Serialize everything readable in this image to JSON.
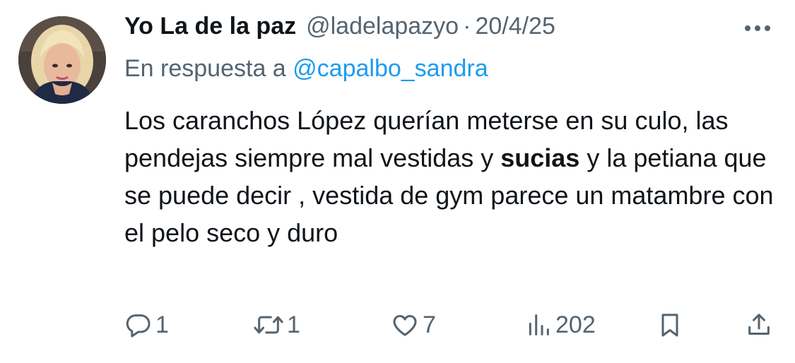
{
  "tweet": {
    "display_name": "Yo La de la paz",
    "handle": "@ladelapazyo",
    "separator": "·",
    "date": "20/4/25",
    "reply_prefix": "En respuesta a",
    "reply_mention": "@capalbo_sandra",
    "text_part1": "Los caranchos López querían meterse en su culo, las pendejas siempre mal vestidas y ",
    "text_bold": "sucias",
    "text_part2": " y la petiana que se puede decir , vestida de gym parece un matambre con el pelo seco y duro"
  },
  "actions": {
    "replies": "1",
    "retweets": "1",
    "likes": "7",
    "views": "202"
  },
  "icons": {
    "more": "more-icon",
    "reply": "reply-icon",
    "retweet": "retweet-icon",
    "like": "heart-icon",
    "views": "views-icon",
    "bookmark": "bookmark-icon",
    "share": "share-icon"
  },
  "colors": {
    "text": "#0f1419",
    "secondary": "#536471",
    "link": "#1d9bf0",
    "background": "#ffffff"
  }
}
